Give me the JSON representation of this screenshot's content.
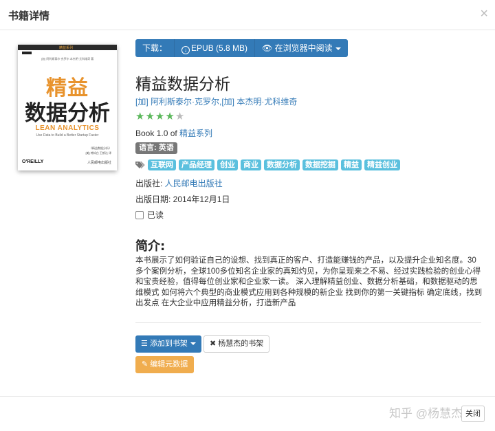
{
  "modal": {
    "title": "书籍详情",
    "close_symbol": "×",
    "close_button": "关闭"
  },
  "cover": {
    "series": "精益系列",
    "authors_small": "[加] 阿利斯泰尔·克罗尔 本杰明·尤科维奇 著",
    "title_line1": "精益",
    "title_line2": "数据分析",
    "en_title": "LEAN ANALYTICS",
    "en_subtitle": "Use Data to Build a Better Startup Faster",
    "translator1": "《精益数据分析》",
    "translator2": "[美] 韩知白 王鹤达 译",
    "publisher_logo": "O'REILLY",
    "press_logo": "人民邮电出版社"
  },
  "download": {
    "label": "下载：",
    "epub": "EPUB (5.8 MB)",
    "read_online": "在浏览器中阅读"
  },
  "book": {
    "title": "精益数据分析",
    "author1": "[加] 阿利斯泰尔·克罗尔",
    "author_sep": ",",
    "author2": "[加] 本杰明·尤科维奇",
    "rating": 4,
    "rating_max": 5,
    "book_prefix": "Book 1.0 of ",
    "series_link": "精益系列",
    "language": "语言: 英语",
    "tags": [
      "互联网",
      "产品经理",
      "创业",
      "商业",
      "数据分析",
      "数据挖掘",
      "精益",
      "精益创业"
    ],
    "publisher_label": "出版社: ",
    "publisher": "人民邮电出版社",
    "pubdate": "出版日期: 2014年12月1日",
    "read_label": "已读",
    "intro_heading": "简介:",
    "intro": "本书展示了如何验证自己的设想、找到真正的客户、打造能赚钱的产品，以及提升企业知名度。30多个案例分析，全球100多位知名企业家的真知灼见，为你呈现来之不易、经过实践检验的创业心得和宝贵经验，值得每位创业家和企业家一读。 深入理解精益创业、数据分析基础，和数据驱动的思维模式 如何将六个典型的商业模式应用到各种规模的新企业 找到你的第一关键指标 确定底线，找到出发点 在大企业中应用精益分析，打造新产品"
  },
  "actions": {
    "add_to_shelf": "添加到书架",
    "owner_shelf": "杨慧杰的书架",
    "edit_metadata": "编辑元数据"
  },
  "watermark": "知乎 @杨慧杰",
  "colors": {
    "primary": "#337ab7",
    "info": "#5bc0de",
    "warning": "#f0ad4e",
    "star": "#5bb75b"
  }
}
